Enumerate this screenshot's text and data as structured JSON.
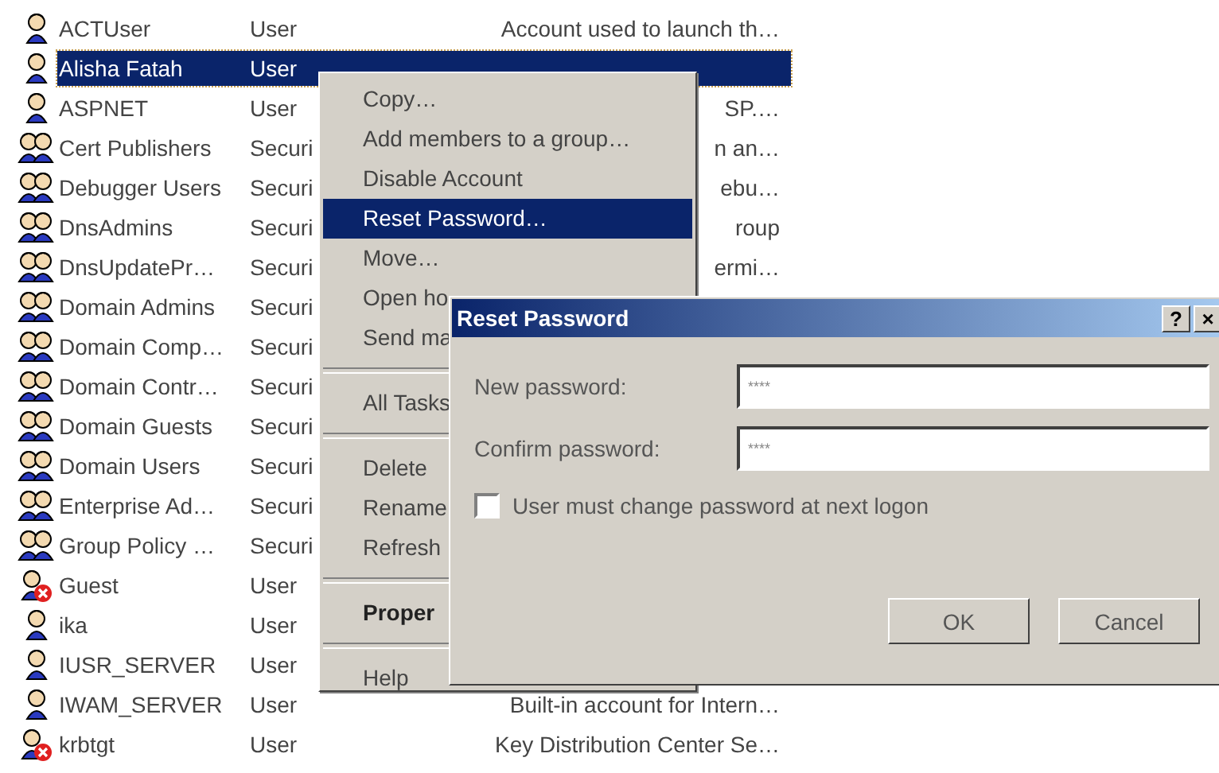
{
  "accounts": [
    {
      "name": "ACTUser",
      "type": "User",
      "description": "Account used to launch th…",
      "kind": "user",
      "selected": false
    },
    {
      "name": "Alisha Fatah",
      "type": "User",
      "kind": "user",
      "selected": true
    },
    {
      "name": "ASPNET",
      "type": "User",
      "description": "SP.…",
      "kind": "user",
      "selected": false
    },
    {
      "name": "Cert Publishers",
      "type": "Securi",
      "description": "n an…",
      "kind": "group",
      "selected": false
    },
    {
      "name": "Debugger Users",
      "type": "Securi",
      "description": "ebu…",
      "kind": "group",
      "selected": false
    },
    {
      "name": "DnsAdmins",
      "type": "Securi",
      "description": "roup",
      "kind": "group",
      "selected": false
    },
    {
      "name": "DnsUpdatePr…",
      "type": "Securi",
      "description": "ermi…",
      "kind": "group",
      "selected": false
    },
    {
      "name": "Domain Admins",
      "type": "Securi",
      "kind": "group",
      "selected": false
    },
    {
      "name": "Domain Comp…",
      "type": "Securi",
      "kind": "group",
      "selected": false
    },
    {
      "name": "Domain Contr…",
      "type": "Securi",
      "kind": "group",
      "selected": false
    },
    {
      "name": "Domain Guests",
      "type": "Securi",
      "kind": "group",
      "selected": false
    },
    {
      "name": "Domain Users",
      "type": "Securi",
      "kind": "group",
      "selected": false
    },
    {
      "name": "Enterprise Ad…",
      "type": "Securi",
      "kind": "group",
      "selected": false
    },
    {
      "name": "Group Policy …",
      "type": "Securi",
      "kind": "group",
      "selected": false
    },
    {
      "name": "Guest",
      "type": "User",
      "kind": "disabled_user",
      "selected": false
    },
    {
      "name": "ika",
      "type": "User",
      "kind": "user",
      "selected": false
    },
    {
      "name": "IUSR_SERVER",
      "type": "User",
      "kind": "user",
      "selected": false
    },
    {
      "name": "IWAM_SERVER",
      "type": "User",
      "description": "Built-in account for Intern…",
      "kind": "user",
      "selected": false
    },
    {
      "name": "krbtgt",
      "type": "User",
      "description": "Key Distribution Center Se…",
      "kind": "disabled_user",
      "selected": false
    }
  ],
  "context_menu": [
    {
      "kind": "item",
      "label": "Copy…",
      "selected": false,
      "default": false
    },
    {
      "kind": "item",
      "label": "Add members to a group…",
      "selected": false,
      "default": false
    },
    {
      "kind": "item",
      "label": "Disable Account",
      "selected": false,
      "default": false
    },
    {
      "kind": "item",
      "label": "Reset Password…",
      "selected": true,
      "default": false
    },
    {
      "kind": "item",
      "label": "Move…",
      "selected": false,
      "default": false
    },
    {
      "kind": "item",
      "label": "Open ho",
      "selected": false,
      "default": false
    },
    {
      "kind": "item",
      "label": "Send ma",
      "selected": false,
      "default": false
    },
    {
      "kind": "separator"
    },
    {
      "kind": "item",
      "label": "All Tasks",
      "selected": false,
      "default": false
    },
    {
      "kind": "separator"
    },
    {
      "kind": "item",
      "label": "Delete",
      "selected": false,
      "default": false
    },
    {
      "kind": "item",
      "label": "Rename",
      "selected": false,
      "default": false
    },
    {
      "kind": "item",
      "label": "Refresh",
      "selected": false,
      "default": false
    },
    {
      "kind": "separator"
    },
    {
      "kind": "item",
      "label": "Proper",
      "selected": false,
      "default": true
    },
    {
      "kind": "separator"
    },
    {
      "kind": "item",
      "label": "Help",
      "selected": false,
      "default": false
    }
  ],
  "dialog": {
    "title": "Reset Password",
    "help_button": "?",
    "close_button": "×",
    "fields": [
      {
        "label": "New password:",
        "value": "****"
      },
      {
        "label": "Confirm password:",
        "value": "****"
      }
    ],
    "checkbox": {
      "label": "User must change password at next logon",
      "checked": false
    },
    "buttons": [
      "OK",
      "Cancel"
    ]
  }
}
